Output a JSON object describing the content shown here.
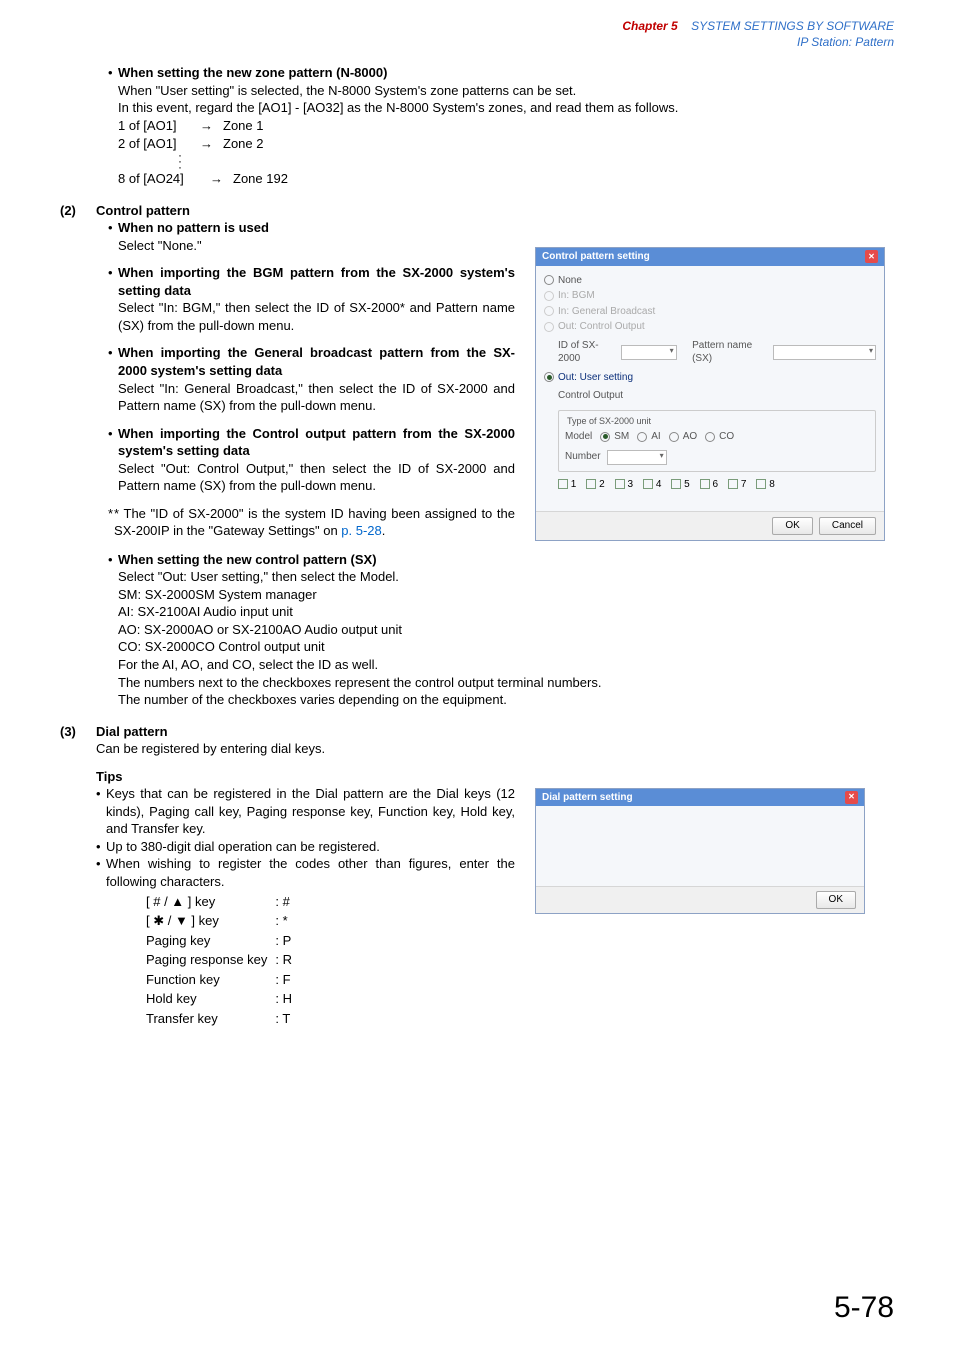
{
  "header": {
    "chapter": "Chapter 5",
    "title": "SYSTEM SETTINGS BY SOFTWARE",
    "subtitle": "IP Station: Pattern"
  },
  "s1": {
    "h": "When setting the new zone pattern (N-8000)",
    "p1": "When \"User setting\" is selected, the N-8000 System's zone patterns can be set.",
    "p2": "In this event, regard the [AO1] - [AO32] as the N-8000 System's zones, and read them as follows.",
    "z1a": "1 of [AO1]",
    "z1b": "Zone 1",
    "z2a": "2 of [AO1]",
    "z2b": "Zone 2",
    "z3a": "8 of [AO24]",
    "z3b": "Zone 192"
  },
  "s2": {
    "num": "(2)",
    "title": "Control pattern",
    "b1h": "When no pattern is used",
    "b1t": "Select \"None.\"",
    "b2h": "When importing the BGM pattern from the SX-2000 system's setting data",
    "b2t": "Select \"In: BGM,\" then select the ID of SX-2000* and Pattern name (SX) from the pull-down menu.",
    "b3h": "When importing the General broadcast pattern from the SX-2000 system's setting data",
    "b3t": "Select \"In: General Broadcast,\" then select the ID of SX-2000 and Pattern name (SX) from the pull-down menu.",
    "b4h": "When importing the Control output pattern from the SX-2000 system's setting data",
    "b4t": "Select \"Out: Control Output,\" then select the ID of SX-2000 and Pattern name (SX) from the pull-down menu.",
    "note": "* The \"ID of SX-2000\" is the system ID having been assigned to the SX-200IP in the \"Gateway Settings\" on ",
    "notelink": "p. 5-28",
    "noteend": ".",
    "b5h": "When setting the new control pattern (SX)",
    "b5t1": "Select \"Out: User setting,\" then select the Model.",
    "sm": "SM:  SX-2000SM System manager",
    "ai": "AI:    SX-2100AI Audio input unit",
    "ao": "AO:  SX-2000AO or SX-2100AO Audio output unit",
    "co": "CO:  SX-2000CO Control output unit",
    "b5t2": "For the AI, AO, and CO, select the ID as well.",
    "b5t3": "The numbers next to the checkboxes represent the control output terminal numbers.",
    "b5t4": "The number of the checkboxes varies depending on the equipment."
  },
  "s3": {
    "num": "(3)",
    "title": "Dial pattern",
    "p1": "Can be registered by entering dial keys.",
    "tipsh": "Tips",
    "t1": "Keys that can be registered in the Dial pattern are the Dial keys (12 kinds), Paging call key, Paging response key, Function key, Hold key, and Transfer key.",
    "t2": "Up to 380-digit dial operation can be registered.",
    "t3": "When wishing to register the codes other than figures, enter the following characters.",
    "k1a": "[ # / ▲ ] key",
    "k1b": ": #",
    "k2a": "[ ✱ / ▼ ] key",
    "k2b": ": *",
    "k3a": "Paging key",
    "k3b": ": P",
    "k4a": "Paging response key",
    "k4b": ": R",
    "k5a": "Function key",
    "k5b": ": F",
    "k6a": "Hold key",
    "k6b": ": H",
    "k7a": "Transfer key",
    "k7b": ": T"
  },
  "dlg1": {
    "title": "Control pattern setting",
    "r1": "None",
    "r2": "In: BGM",
    "r3": "In: General Broadcast",
    "r4": "Out: Control Output",
    "idlbl": "ID of SX-2000",
    "pnlbl": "Pattern name (SX)",
    "r5": "Out: User setting",
    "cohdr": "Control Output",
    "legend": "Type of SX-2000 unit",
    "model": "Model",
    "mSM": "SM",
    "mAI": "AI",
    "mAO": "AO",
    "mCO": "CO",
    "number": "Number",
    "n1": "1",
    "n2": "2",
    "n3": "3",
    "n4": "4",
    "n5": "5",
    "n6": "6",
    "n7": "7",
    "n8": "8",
    "ok": "OK",
    "cancel": "Cancel"
  },
  "dlg2": {
    "title": "Dial pattern setting",
    "ok": "OK"
  },
  "footer": "5-78"
}
